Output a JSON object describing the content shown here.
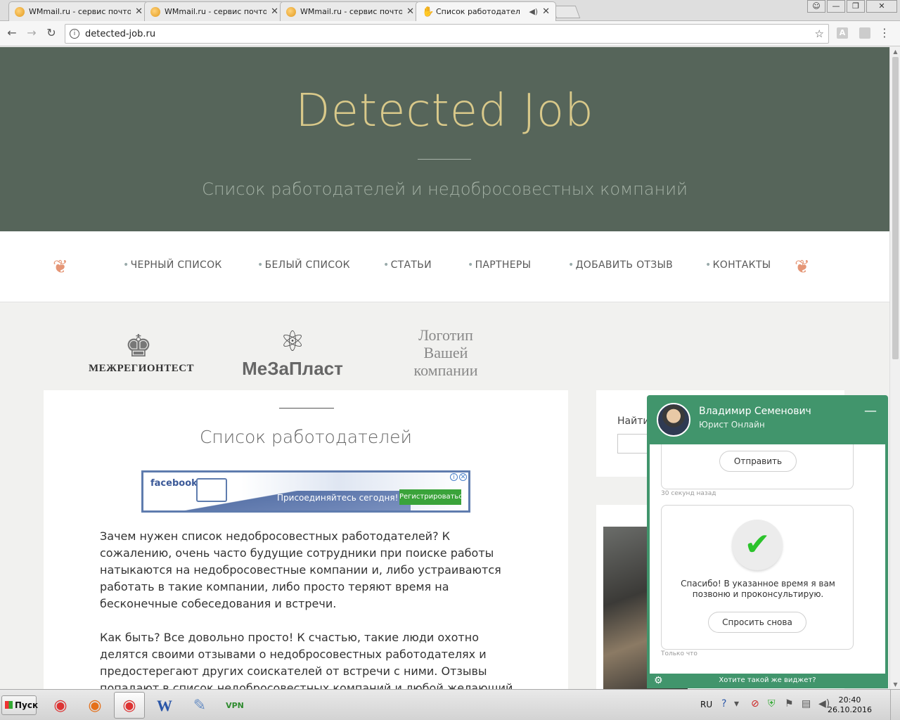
{
  "browser": {
    "tabs": [
      {
        "title": "WMmail.ru - сервис почтов",
        "icon": "wmmail-favicon",
        "active": false
      },
      {
        "title": "WMmail.ru - сервис почтов",
        "icon": "wmmail-favicon",
        "active": false
      },
      {
        "title": "WMmail.ru - сервис почтов",
        "icon": "wmmail-favicon",
        "active": false
      },
      {
        "title": "Список работодател",
        "icon": "hand-icon",
        "active": true
      }
    ],
    "url": "detected-job.ru"
  },
  "site": {
    "title": "Detected Job",
    "tagline": "Список работодателей и недобросовестных компаний",
    "nav": [
      "ЧЕРНЫЙ СПИСОК",
      "БЕЛЫЙ СПИСОК",
      "СТАТЬИ",
      "ПАРТНЕРЫ",
      "ДОБАВИТЬ ОТЗЫВ",
      "КОНТАКТЫ"
    ],
    "partners": {
      "logo1": "МЕЖРЕГИОНТЕСТ",
      "logo2": "МеЗаПласт",
      "logo3": [
        "Логотип",
        "Вашей",
        "компании"
      ]
    },
    "heading": "Список работодателей",
    "ad": {
      "brand": "facebook",
      "text": "Присоединяйтесь сегодня!",
      "button": "Регистрироваться"
    },
    "paragraphs": [
      "Зачем нужен список недобросовестных работодателей? К сожалению, очень часто будущие сотрудники при поиске работы натыкаются на недобросовестные компании и, либо устраиваются работать в такие компании, либо просто теряют время на бесконечные собеседования и встречи.",
      "Как быть? Все довольно просто! К счастью, такие люди охотно делятся своими отзывами о недобросовестных работодателях и предостерегают других соискателей от встречи с ними. Отзывы попадают в список недобросовестных компаний и любой желающий может ознакомиться с"
    ],
    "sidebar": {
      "search_label": "Найти"
    }
  },
  "chat": {
    "name": "Владимир Семенович",
    "role": "Юрист Онлайн",
    "send_button": "Отправить",
    "time1": "30 секунд назад",
    "thanks": "Спасибо! В указанное время я вам позвоню и проконсультирую.",
    "ask_again": "Спросить снова",
    "time2": "Только что",
    "footer": "Хотите такой же виджет?"
  },
  "taskbar": {
    "start": "Пуск",
    "lang": "RU",
    "time": "20:40",
    "date": "26.10.2016"
  },
  "colors": {
    "hero_bg": "#56655a",
    "hero_title": "#d9c98a",
    "accent_ornament": "#e59676",
    "chat_green": "#41956c"
  }
}
